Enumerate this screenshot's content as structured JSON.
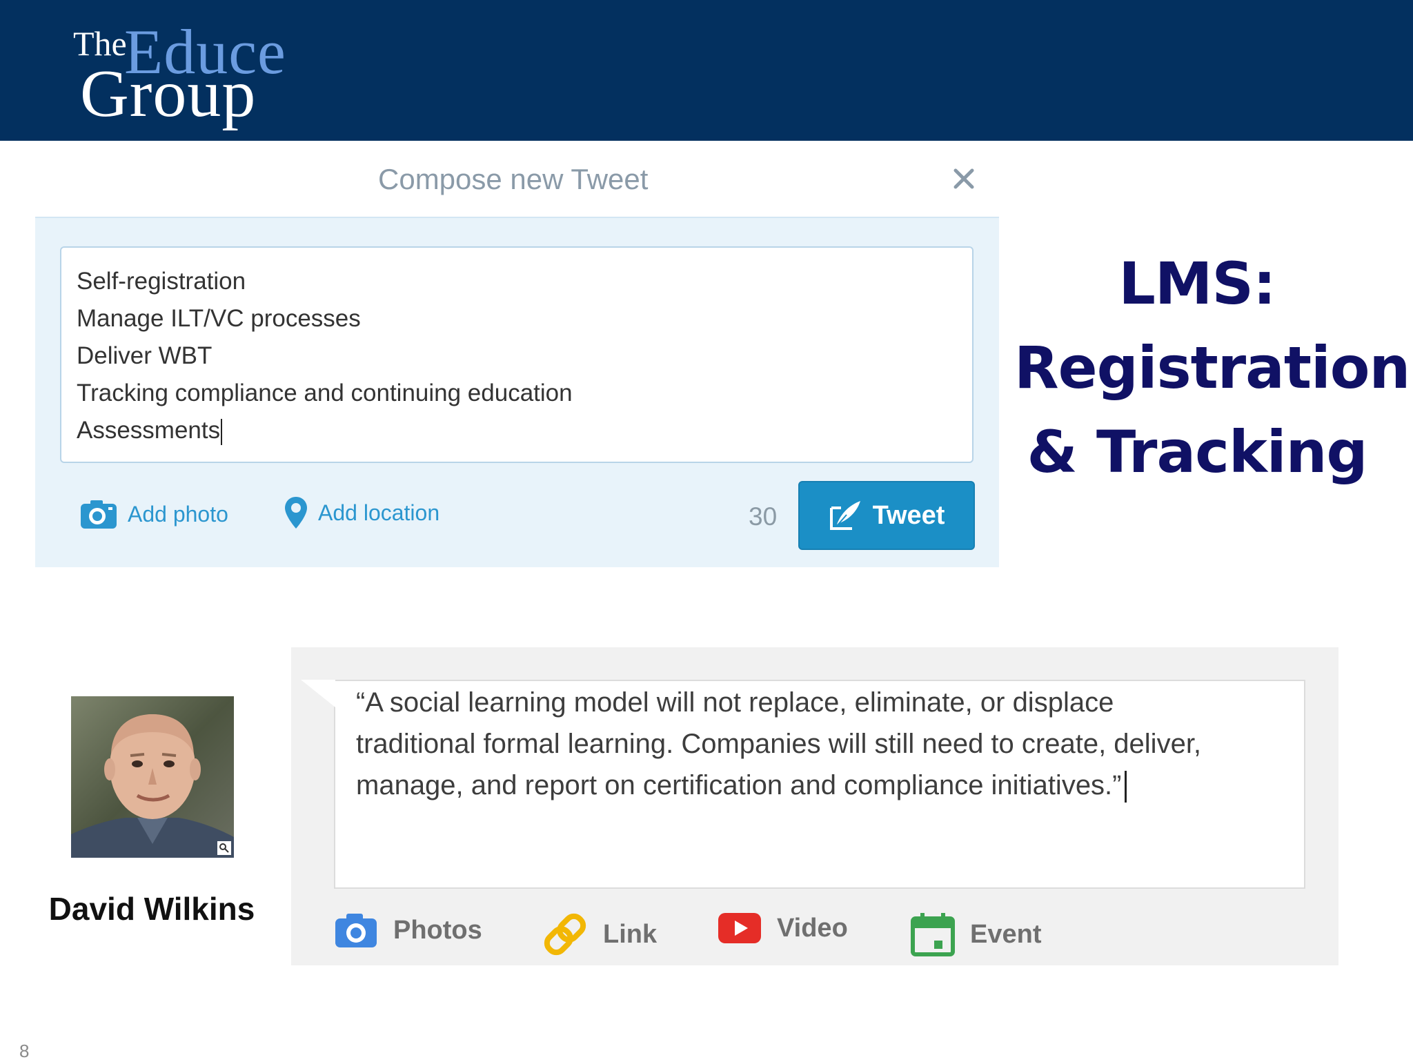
{
  "header": {
    "logo": {
      "the": "The",
      "educe": "Educe",
      "group": "Group"
    }
  },
  "compose": {
    "title": "Compose new Tweet",
    "close_icon": "close-icon",
    "lines": [
      "Self-registration",
      "Manage ILT/VC processes",
      "Deliver WBT",
      "Tracking compliance and continuing education",
      "Assessments"
    ],
    "add_photo": "Add photo",
    "add_location": "Add location",
    "char_count": "30",
    "tweet_button": "Tweet"
  },
  "slide_title": {
    "line1": "LMS:",
    "line2": "Registration",
    "line3": "& Tracking"
  },
  "author": {
    "name": "David Wilkins"
  },
  "post": {
    "quote_lines": [
      "“A social learning model will not replace, eliminate, or displace",
      "traditional formal learning.  Companies will still need to create, deliver,",
      "manage, and report on certification and compliance initiatives.”"
    ],
    "actions": {
      "photos": "Photos",
      "link": "Link",
      "video": "Video",
      "event": "Event"
    }
  },
  "slide_number": "8",
  "colors": {
    "header_bg": "#03305f",
    "title": "#101165",
    "tweet_blue": "#1b8fc6",
    "link_blue": "#2b96cf"
  }
}
